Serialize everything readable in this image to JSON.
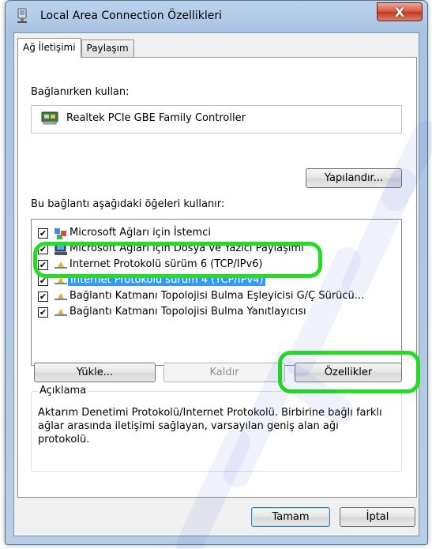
{
  "window": {
    "title": "Local Area Connection Özellikleri",
    "close_glyph": "X"
  },
  "tabs": [
    {
      "label": "Ağ İletişimi",
      "active": true
    },
    {
      "label": "Paylaşım",
      "active": false
    }
  ],
  "connect_using": {
    "label": "Bağlanırken kullan:",
    "adapter": "Realtek PCIe GBE Family Controller",
    "configure_button": "Yapılandır..."
  },
  "items_section": {
    "label": "Bu bağlantı aşağıdaki öğeleri kullanır:",
    "items": [
      {
        "label": "Microsoft Ağları için İstemci",
        "checked": true,
        "icon": "network-client-icon",
        "selected": false
      },
      {
        "label": "Microsoft Ağları için Dosya ve Yazıcı Paylaşımı",
        "checked": true,
        "icon": "printer-share-icon",
        "selected": false
      },
      {
        "label": "Internet Protokolü sürüm 6 (TCP/IPv6)",
        "checked": true,
        "icon": "protocol-icon",
        "selected": false
      },
      {
        "label": "Internet Protokolü sürüm 4 (TCP/IPv4)",
        "checked": true,
        "icon": "protocol-icon",
        "selected": true
      },
      {
        "label": "Bağlantı Katmanı Topolojisi Bulma Eşleyicisi G/Ç Sürücü...",
        "checked": true,
        "icon": "protocol-icon",
        "selected": false
      },
      {
        "label": "Bağlantı Katmanı Topolojisi Bulma Yanıtlayıcısı",
        "checked": true,
        "icon": "protocol-icon",
        "selected": false
      }
    ],
    "check_glyph": "✔"
  },
  "item_buttons": {
    "install": "Yükle...",
    "uninstall": "Kaldır",
    "properties": "Özellikler"
  },
  "description": {
    "title": "Açıklama",
    "text": "Aktarım Denetimi Protokolü/Internet Protokolü. Birbirine bağlı farklı ağlar arasında iletişimi sağlayan, varsayılan geniş alan ağı protokolü."
  },
  "footer": {
    "ok": "Tamam",
    "cancel": "İptal"
  },
  "colors": {
    "highlight": "#22dd22",
    "selection": "#3399ff"
  }
}
